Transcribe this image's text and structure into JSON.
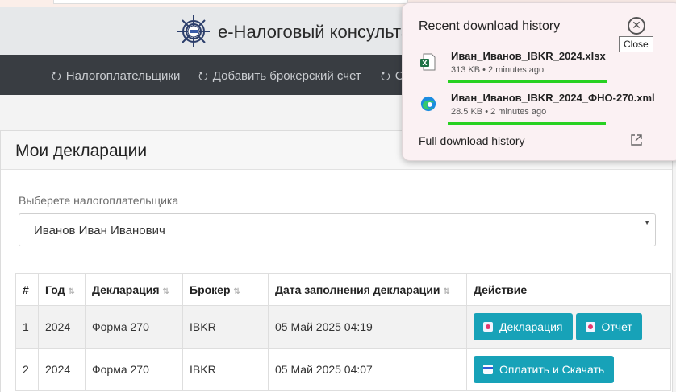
{
  "header": {
    "brand": "е-Налоговый консульта",
    "logo_icon": "ship-wheel-icon"
  },
  "nav": {
    "glyph": "⭮",
    "items": [
      {
        "label": "Налогоплательщики"
      },
      {
        "label": "Добавить брокерский счет"
      },
      {
        "label": "С"
      }
    ]
  },
  "page": {
    "title": "Мои декларации",
    "select_label": "Выберете налогоплательщика",
    "select_value": "Иванов Иван Иванович"
  },
  "table": {
    "columns": [
      "#",
      "Год",
      "Декларация",
      "Брокер",
      "Дата заполнения декларации",
      "Действие"
    ],
    "sort_glyph": "⇅",
    "rows": [
      {
        "num": "1",
        "year": "2024",
        "decl": "Форма 270",
        "broker": "IBKR",
        "date": "05 Май 2025 04:19",
        "actions": [
          {
            "label": "Декларация",
            "icon": "document-icon"
          },
          {
            "label": "Отчет",
            "icon": "document-icon"
          }
        ]
      },
      {
        "num": "2",
        "year": "2024",
        "decl": "Форма 270",
        "broker": "IBKR",
        "date": "05 Май 2025 04:07",
        "actions": [
          {
            "label": "Оплатить и Скачать",
            "icon": "credit-card-icon"
          }
        ]
      }
    ]
  },
  "downloads": {
    "title": "Recent download history",
    "close_symbol": "✕",
    "close_tooltip": "Close",
    "items": [
      {
        "name": "Иван_Иванов_IBKR_2024.xlsx",
        "meta": "313 KB • 2 minutes ago",
        "icon": "excel-file-icon"
      },
      {
        "name": "Иван_Иванов_IBKR_2024_ФНО-270.xml",
        "meta": "28.5 KB • 2 minutes ago",
        "icon": "edge-browser-icon"
      }
    ],
    "full_history": "Full download history"
  },
  "colors": {
    "accent": "#17a2b8",
    "nav_bg": "#393d42",
    "highlight": "#27d121"
  }
}
